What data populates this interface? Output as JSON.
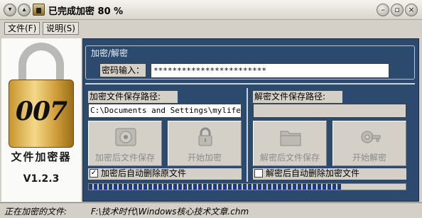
{
  "window": {
    "title": "已完成加密 80 %",
    "controls": [
      "minimize-icon",
      "maximize-icon",
      "close-icon"
    ]
  },
  "menu": {
    "items": [
      {
        "label": "文件(F)"
      },
      {
        "label": "说明(S)"
      }
    ]
  },
  "branding": {
    "logo_text": "007",
    "app_name": "文件加密器",
    "version": "V1.2.3"
  },
  "password": {
    "group_label": "加密/解密",
    "label": "密码输入：",
    "value": "************************"
  },
  "encrypt": {
    "path_label": "加密文件保存路径:",
    "path_value": "C:\\Documents and Settings\\mylife",
    "save_button": "加密后文件保存",
    "start_button": "开始加密",
    "auto_delete_label": "加密后自动删除原文件",
    "auto_delete_checked": true
  },
  "decrypt": {
    "path_label": "解密文件保存路径:",
    "path_value": "",
    "save_button": "解密后文件保存",
    "start_button": "开始解密",
    "auto_delete_label": "解密后自动删除加密文件",
    "auto_delete_checked": false
  },
  "progress": {
    "percent": 80
  },
  "status": {
    "label": "正在加密的文件:",
    "value": "F:\\技术时代\\Windows核心技术文章.chm"
  },
  "colors": {
    "panel_bg": "#2c4a6e",
    "window_bg": "#d4d0c8",
    "progress": "#1c3a8a"
  }
}
